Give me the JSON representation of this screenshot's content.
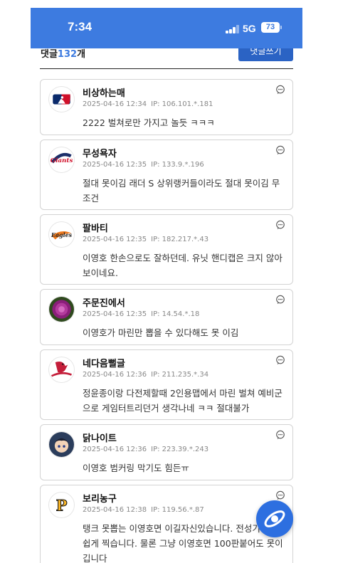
{
  "status_bar": {
    "time": "7:34",
    "network": "5G",
    "battery": "73"
  },
  "comments_header": {
    "label": "댓글",
    "count": "132",
    "suffix": "개",
    "write_button": "댓글쓰기"
  },
  "comments": [
    {
      "nickname": "비상하는매",
      "date": "2025-04-16 12:34",
      "ip": "IP: 106.101.*.181",
      "text": "2222 벌쳐로만 가지고 놀듯 ㅋㅋㅋ",
      "avatar_icon": "mlb-logo-icon"
    },
    {
      "nickname": "무성욕자",
      "date": "2025-04-16 12:35",
      "ip": "IP: 133.9.*.196",
      "text": "절대 못이김 래더 S 상위랭커들이라도 절대 못이김 무조건",
      "avatar_icon": "giants-logo-icon"
    },
    {
      "nickname": "팔바티",
      "date": "2025-04-16 12:35",
      "ip": "IP: 182.217.*.43",
      "text": "이영호 한손으로도 잘하던데. 유닛 핸디캡은 크지 않아보이네요.",
      "avatar_icon": "eagles-logo-icon"
    },
    {
      "nickname": "주문진에서",
      "date": "2025-04-16 12:35",
      "ip": "IP: 14.54.*.18",
      "text": "이영호가 마린만 뽑을 수 있다해도 못 이김",
      "avatar_icon": "flower-avatar-icon"
    },
    {
      "nickname": "네다음뻘글",
      "date": "2025-04-16 12:36",
      "ip": "IP: 211.235.*.34",
      "text": "정윤종이랑 다전제할때 2인용맵에서 마린 벌쳐 예비군으로 게임터트리던거 생각나네 ㅋㅋ 절대불가",
      "avatar_icon": "cardinals-logo-icon"
    },
    {
      "nickname": "닭나이트",
      "date": "2025-04-16 12:36",
      "ip": "IP: 223.39.*.243",
      "text": "이영호 범커링 막기도 힘든ㅠ",
      "avatar_icon": "anime-avatar-icon"
    },
    {
      "nickname": "보리농구",
      "date": "2025-04-16 12:38",
      "ip": "IP: 119.56.*.87",
      "text": "탱크 못뽑는 이영호면 이길자신있습니다. 전성기 S는 쉽게 찍습니다. 물론 그냥 이영호면 100판붙어도 못이깁니다",
      "avatar_icon": "pirates-logo-icon"
    }
  ],
  "colors": {
    "accent": "#3d7be0",
    "button": "#2b63c4"
  }
}
